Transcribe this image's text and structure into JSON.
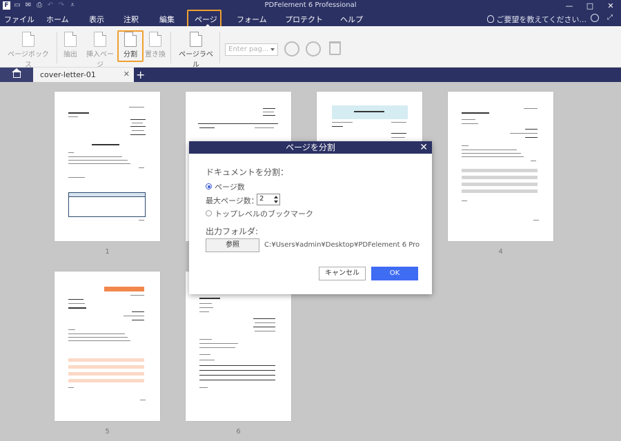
{
  "app": {
    "title": "PDFelement 6 Professional",
    "quick_access": [
      "logo-icon",
      "save-icon",
      "email-icon",
      "print-icon",
      "undo-icon",
      "redo-icon",
      "customize-icon"
    ]
  },
  "menu": {
    "items": [
      "ファイル",
      "ホーム",
      "表示",
      "注釈",
      "編集",
      "ページ",
      "フォーム",
      "プロテクト",
      "ヘルプ"
    ],
    "active": "ページ",
    "help_text": "ご要望を教えてください..."
  },
  "ribbon": {
    "page_box": "ページボックス",
    "extract": "抽出",
    "insert_page": "挿入ページ",
    "split": "分割",
    "replace": "置き換",
    "page_label": "ページラベル",
    "page_input_placeholder": "Enter pag..."
  },
  "tabs": {
    "document": "cover-letter-01",
    "close_symbol": "✕",
    "add_symbol": "+"
  },
  "pages": {
    "numbers": [
      "1",
      "4",
      "5",
      "6"
    ]
  },
  "dialog": {
    "title": "ページを分割",
    "close_symbol": "✕",
    "split_by_label": "ドキュメントを分割：",
    "option_page_count": "ページ数",
    "max_pages_label": "最大ページ数：",
    "max_pages_value": "2",
    "option_bookmark": "トップレベルのブックマーク",
    "output_folder_label": "出力フォルダ:",
    "browse_button": "参照",
    "output_path": "C:¥Users¥admin¥Desktop¥PDFelement 6 Pro",
    "cancel_button": "キャンセル",
    "ok_button": "OK"
  },
  "colors": {
    "title_bar": "#2b3163",
    "highlight": "#f0a030",
    "ok_button": "#3e6cf3",
    "workspace": "#c7c7c7"
  }
}
